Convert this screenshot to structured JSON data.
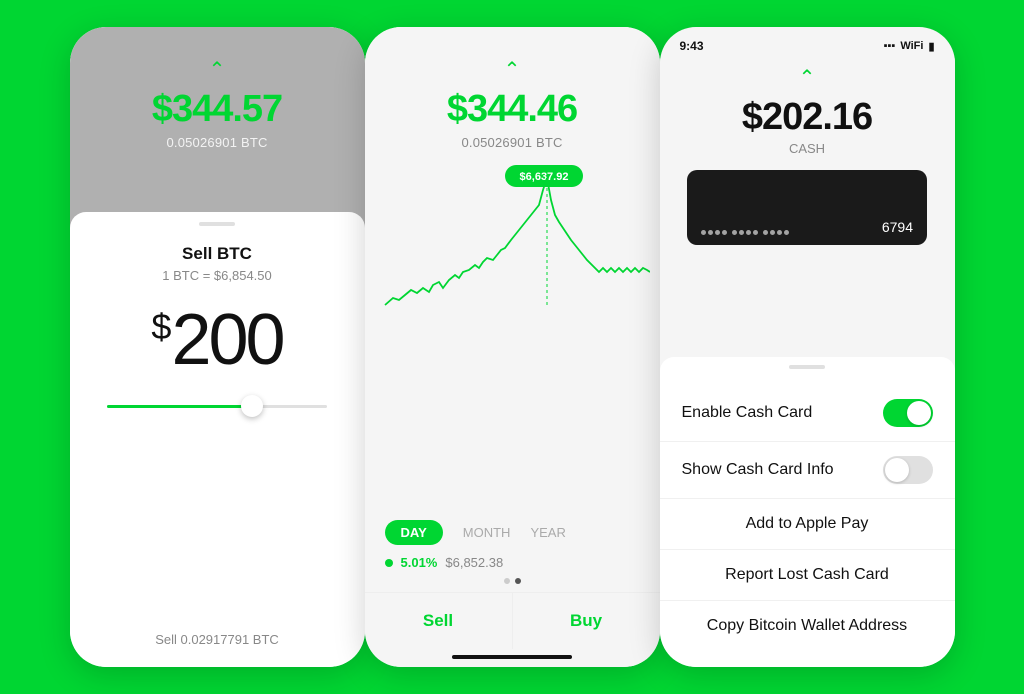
{
  "panel1": {
    "balance": "$344.57",
    "balance_sub": "0.05026901 BTC",
    "chevron": "^",
    "sell_title": "Sell BTC",
    "sell_rate": "1 BTC = $6,854.50",
    "dollar_symbol": "$",
    "dollar_amount": "200",
    "sell_label": "Sell 0.02917791 BTC"
  },
  "panel2": {
    "balance": "$344.46",
    "balance_sub": "0.05026901 BTC",
    "chevron": "^",
    "tooltip_price": "$6,637.92",
    "tab_day": "DAY",
    "tab_month": "MONTH",
    "tab_year": "YEAR",
    "stat_pct": "5.01%",
    "stat_price": "$6,852.38",
    "sell_label": "Sell",
    "buy_label": "Buy"
  },
  "panel3": {
    "status_time": "9:43",
    "chevron": "^",
    "balance": "$202.16",
    "balance_label": "CASH",
    "card_last4": "6794",
    "enable_label": "Enable Cash Card",
    "show_info_label": "Show Cash Card Info",
    "apple_pay_label": "Add to Apple Pay",
    "report_label": "Report Lost Cash Card",
    "copy_label": "Copy Bitcoin Wallet Address"
  },
  "colors": {
    "green": "#00d632",
    "dark": "#111111",
    "gray": "#888888"
  }
}
